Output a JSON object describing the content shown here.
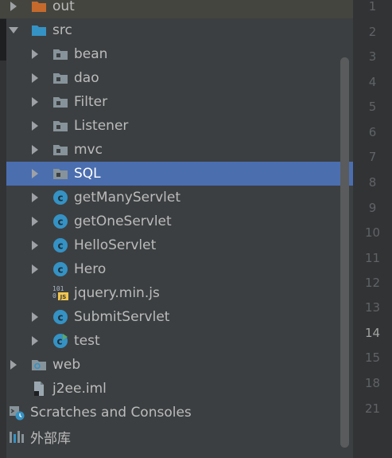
{
  "colors": {
    "background": "#3c3f41",
    "selection": "#4b6eaf",
    "gutter": "#313335",
    "folder": "#87939a",
    "source_folder": "#3592c4",
    "class_icon": "#3592c4",
    "out_folder": "#c56a2c"
  },
  "tree": {
    "items": [
      {
        "label": "out",
        "icon": "excluded-folder-icon",
        "expandable": true,
        "expanded": false
      },
      {
        "label": "src",
        "icon": "source-folder-icon",
        "expandable": true,
        "expanded": true
      },
      {
        "label": "bean",
        "icon": "package-icon",
        "expandable": true,
        "expanded": false
      },
      {
        "label": "dao",
        "icon": "package-icon",
        "expandable": true,
        "expanded": false
      },
      {
        "label": "Filter",
        "icon": "package-icon",
        "expandable": true,
        "expanded": false
      },
      {
        "label": "Listener",
        "icon": "package-icon",
        "expandable": true,
        "expanded": false
      },
      {
        "label": "mvc",
        "icon": "package-icon",
        "expandable": true,
        "expanded": false
      },
      {
        "label": "SQL",
        "icon": "package-icon",
        "expandable": true,
        "expanded": false,
        "selected": true
      },
      {
        "label": "getManyServlet",
        "icon": "class-icon",
        "expandable": true,
        "expanded": false
      },
      {
        "label": "getOneServlet",
        "icon": "class-icon",
        "expandable": true,
        "expanded": false
      },
      {
        "label": "HelloServlet",
        "icon": "class-icon",
        "expandable": true,
        "expanded": false
      },
      {
        "label": "Hero",
        "icon": "class-icon",
        "expandable": true,
        "expanded": false
      },
      {
        "label": "jquery.min.js",
        "icon": "javascript-file-icon",
        "expandable": false
      },
      {
        "label": "SubmitServlet",
        "icon": "class-icon",
        "expandable": true,
        "expanded": false
      },
      {
        "label": "test",
        "icon": "runnable-class-icon",
        "expandable": true,
        "expanded": false
      },
      {
        "label": "web",
        "icon": "web-folder-icon",
        "expandable": true,
        "expanded": false
      },
      {
        "label": "j2ee.iml",
        "icon": "module-file-icon",
        "expandable": false
      },
      {
        "label": "Scratches and Consoles",
        "icon": "scratches-icon",
        "expandable": true,
        "expanded": false
      },
      {
        "label": "外部库",
        "icon": "libraries-icon",
        "expandable": true,
        "expanded": false
      }
    ]
  },
  "gutter": {
    "line_numbers": [
      "1",
      "2",
      "3",
      "4",
      "5",
      "6",
      "7",
      "8",
      "9",
      "10",
      "11",
      "12",
      "13",
      "14",
      "15",
      "18",
      "21"
    ],
    "current_line": "14"
  }
}
